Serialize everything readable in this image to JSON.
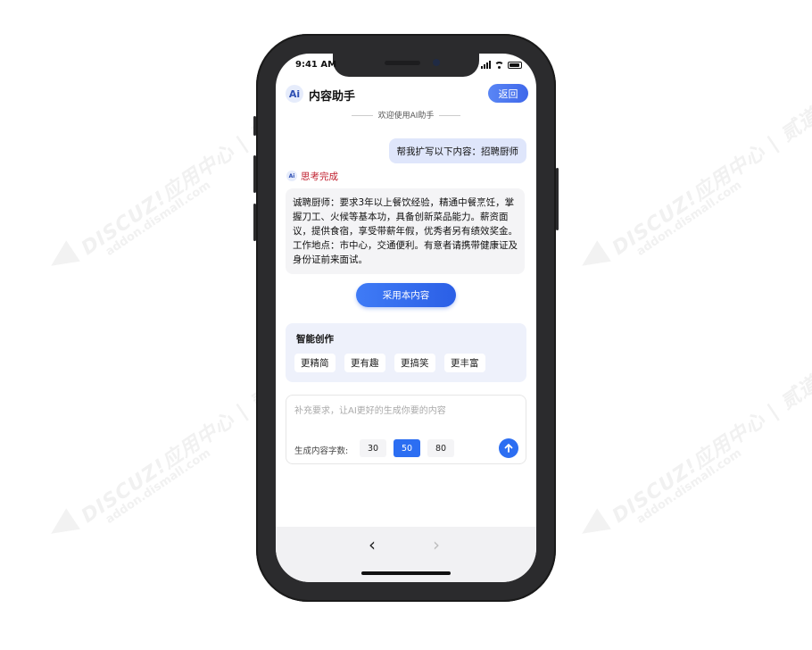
{
  "watermark": {
    "line1": "DISCUZ!应用中心 | 贰道",
    "line2": "addon.dismall.com"
  },
  "status_bar": {
    "time": "9:41 AM"
  },
  "header": {
    "logo_text": "Ai",
    "title": "内容助手",
    "back_label": "返回"
  },
  "chat": {
    "welcome": "欢迎使用AI助手",
    "user_message": "帮我扩写以下内容：招聘厨师",
    "ai_badge": "Ai",
    "ai_status": "思考完成",
    "ai_answer": "诚聘厨师：要求3年以上餐饮经验，精通中餐烹饪，掌握刀工、火候等基本功，具备创新菜品能力。薪资面议，提供食宿，享受带薪年假，优秀者另有绩效奖金。工作地点：市中心，交通便利。有意者请携带健康证及身份证前来面试。",
    "adopt_label": "采用本内容"
  },
  "smart_create": {
    "title": "智能创作",
    "chips": [
      "更精简",
      "更有趣",
      "更搞笑",
      "更丰富"
    ]
  },
  "input": {
    "placeholder": "补充要求，让AI更好的生成你要的内容",
    "count_label": "生成内容字数:",
    "count_options": [
      "30",
      "50",
      "80"
    ],
    "selected_count": "50",
    "send_icon": "arrow-up-icon"
  },
  "browser_nav": {
    "back_icon": "‹",
    "forward_icon": "›"
  },
  "colors": {
    "accent": "#2c6ef2",
    "status_red": "#c0212f",
    "bubble_user": "#dfe6fb",
    "phone_frame": "#2b2b2d"
  }
}
